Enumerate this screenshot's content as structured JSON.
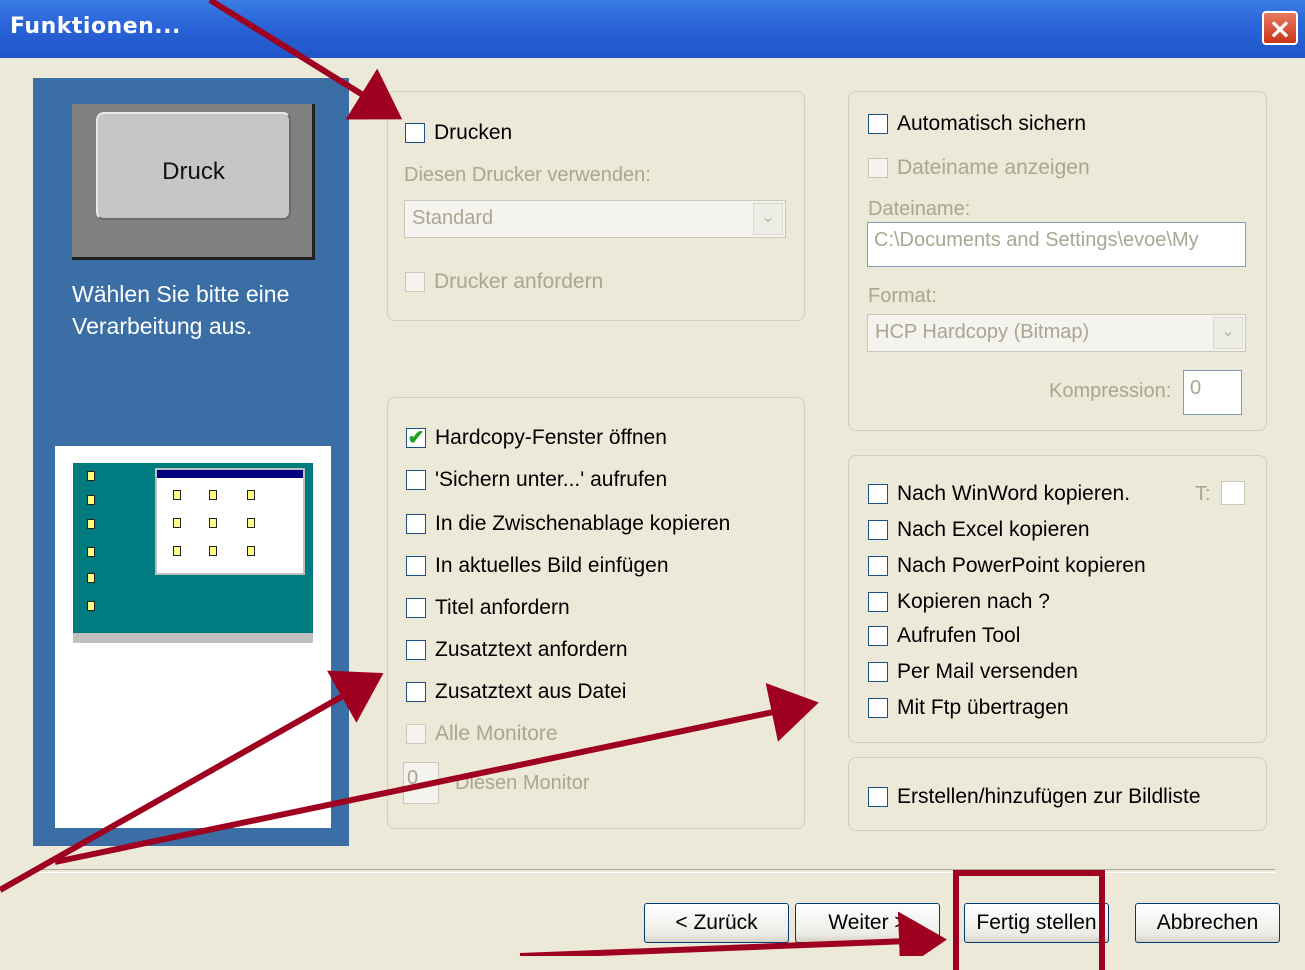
{
  "window": {
    "title": "Funktionen..."
  },
  "side": {
    "key_label": "Druck",
    "description": "Wählen Sie bitte eine Verarbeitung aus."
  },
  "print_group": {
    "drucken": {
      "label": "Drucken",
      "checked": false
    },
    "printer_label": "Diesen Drucker verwenden:",
    "printer_value": "Standard",
    "request_printer": {
      "label": "Drucker anfordern",
      "checked": false
    }
  },
  "actions_group": {
    "items": [
      {
        "label": "Hardcopy-Fenster öffnen",
        "checked": true,
        "mark": "✔"
      },
      {
        "label": "'Sichern unter...' aufrufen",
        "checked": false
      },
      {
        "label": "In die Zwischenablage kopieren",
        "checked": false
      },
      {
        "label": "In aktuelles Bild einfügen",
        "checked": false
      },
      {
        "label": "Titel anfordern",
        "checked": false
      },
      {
        "label": "Zusatztext anfordern",
        "checked": false
      },
      {
        "label": "Zusatztext aus Datei",
        "checked": false
      },
      {
        "label": "Alle Monitore",
        "checked": false,
        "disabled": true
      }
    ],
    "monitor_value": "0",
    "monitor_label": "Diesen Monitor"
  },
  "save_group": {
    "auto_save": {
      "label": "Automatisch sichern",
      "checked": false
    },
    "show_filename": {
      "label": "Dateiname anzeigen",
      "checked": false
    },
    "filename_label": "Dateiname:",
    "filename_value": "C:\\Documents and Settings\\evoe\\My",
    "format_label": "Format:",
    "format_value": "HCP  Hardcopy (Bitmap)",
    "compression_label": "Kompression:",
    "compression_value": "0"
  },
  "export_group": {
    "items": [
      {
        "label": "Nach WinWord kopieren.",
        "checked": false
      },
      {
        "label": "Nach Excel kopieren",
        "checked": false
      },
      {
        "label": "Nach PowerPoint kopieren",
        "checked": false
      },
      {
        "label": "Kopieren nach ?",
        "checked": false
      },
      {
        "label": "Aufrufen Tool",
        "checked": false
      },
      {
        "label": "Per Mail versenden",
        "checked": false
      },
      {
        "label": "Mit Ftp übertragen",
        "checked": false
      }
    ],
    "t_label": "T:"
  },
  "list_group": {
    "item": {
      "label": "Erstellen/hinzufügen zur Bildliste",
      "checked": false
    }
  },
  "buttons": {
    "back": "< Zurück",
    "next": "Weiter >",
    "finish": "Fertig stellen",
    "cancel": "Abbrechen"
  },
  "colors": {
    "title_bar": "#2a63d8",
    "side_panel": "#3a6ea5",
    "dialog_bg": "#ece9d8",
    "annotation": "#a00020",
    "check_mark": "#21a121"
  },
  "icons": {
    "close": "close-icon",
    "dropdown": "chevron-down-icon",
    "check": "check-icon"
  }
}
